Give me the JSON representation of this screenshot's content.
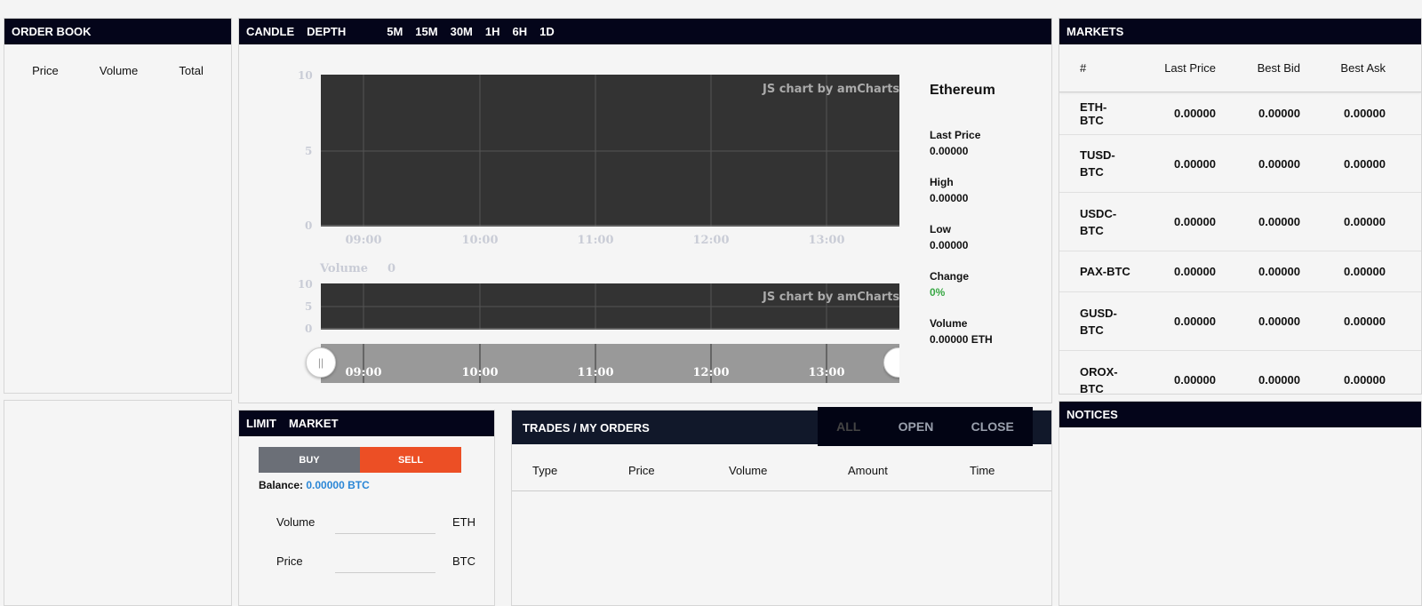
{
  "order_book": {
    "title": "ORDER BOOK",
    "columns": [
      "Price",
      "Volume",
      "Total"
    ]
  },
  "chart_panel": {
    "tabs": [
      "CANDLE",
      "DEPTH"
    ],
    "timeframes": [
      "5M",
      "15M",
      "30M",
      "1H",
      "6H",
      "1D"
    ],
    "watermark": "JS chart by amCharts",
    "price_y_ticks": [
      "10",
      "5",
      "0"
    ],
    "volume_y_ticks": [
      "10",
      "5",
      "0"
    ],
    "x_ticks": [
      "09:00",
      "10:00",
      "11:00",
      "12:00",
      "13:00"
    ],
    "volume_label": "Volume",
    "volume_value": "0",
    "chart_bg": "#333333",
    "scroll_bg": "#999999"
  },
  "stats": {
    "title": "Ethereum",
    "last_price_label": "Last Price",
    "last_price": "0.00000",
    "high_label": "High",
    "high": "0.00000",
    "low_label": "Low",
    "low": "0.00000",
    "change_label": "Change",
    "change": "0%",
    "volume_label": "Volume",
    "volume": "0.00000 ETH"
  },
  "markets": {
    "title": "MARKETS",
    "columns": [
      "#",
      "Last Price",
      "Best Bid",
      "Best Ask"
    ],
    "rows": [
      {
        "pair": "ETH-BTC",
        "last": "0.00000",
        "bid": "0.00000",
        "ask": "0.00000"
      },
      {
        "pair": "TUSD-BTC",
        "last": "0.00000",
        "bid": "0.00000",
        "ask": "0.00000"
      },
      {
        "pair": "USDC-BTC",
        "last": "0.00000",
        "bid": "0.00000",
        "ask": "0.00000"
      },
      {
        "pair": "PAX-BTC",
        "last": "0.00000",
        "bid": "0.00000",
        "ask": "0.00000"
      },
      {
        "pair": "GUSD-BTC",
        "last": "0.00000",
        "bid": "0.00000",
        "ask": "0.00000"
      },
      {
        "pair": "OROX-BTC",
        "last": "0.00000",
        "bid": "0.00000",
        "ask": "0.00000"
      }
    ]
  },
  "notices": {
    "title": "NOTICES"
  },
  "order_form": {
    "tabs": [
      "LIMIT",
      "MARKET"
    ],
    "buy_label": "BUY",
    "sell_label": "SELL",
    "balance_label": "Balance:",
    "balance_value": "0.00000 BTC",
    "volume_label": "Volume",
    "volume_unit": "ETH",
    "price_label": "Price",
    "price_unit": "BTC"
  },
  "trades": {
    "title": "TRADES / MY ORDERS",
    "filters": [
      "ALL",
      "OPEN",
      "CLOSE"
    ],
    "columns": [
      "Type",
      "Price",
      "Volume",
      "Amount",
      "Time"
    ]
  },
  "colors": {
    "header_bg": "#04051a",
    "sell": "#ec4f25",
    "buy": "#6b6f77",
    "balance": "#2a86d6",
    "positive": "#39a845"
  }
}
